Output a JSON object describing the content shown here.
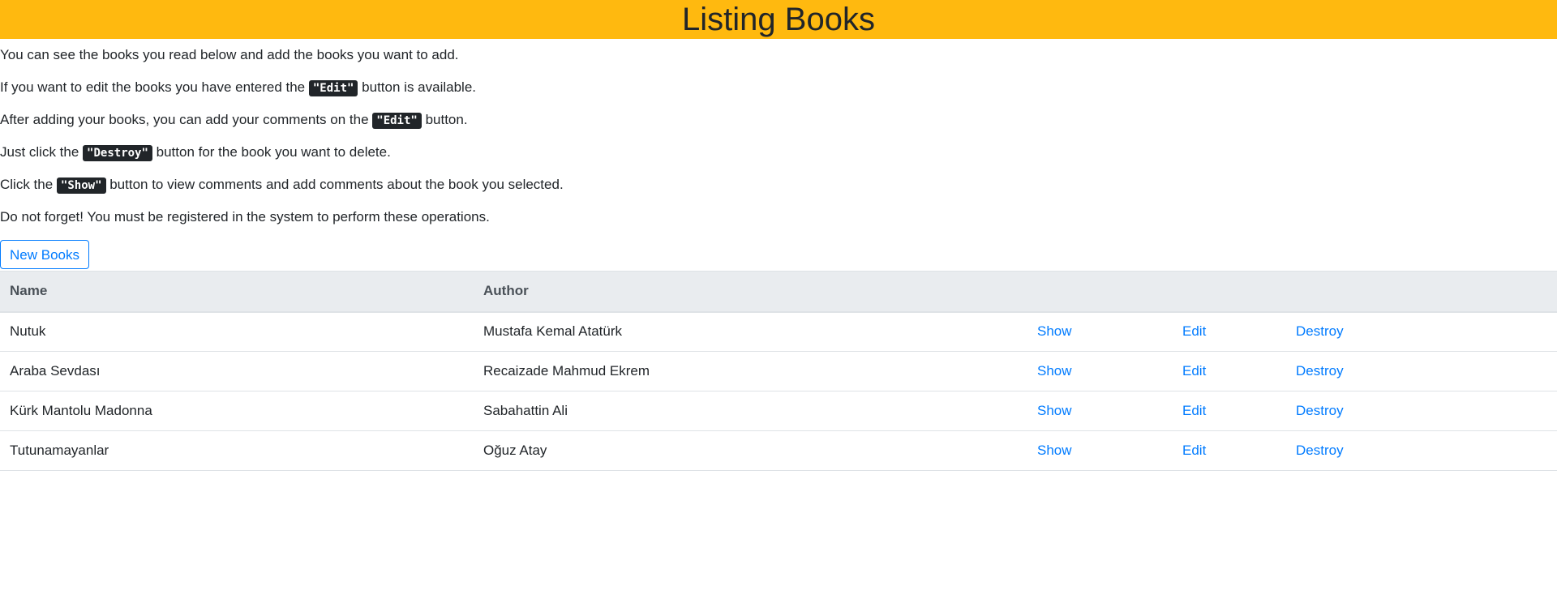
{
  "header": {
    "title": "Listing Books"
  },
  "intro": {
    "line1": "You can see the books you read below and add the books you want to add.",
    "line2_pre": "If you want to edit the books you have entered the ",
    "line2_code": "\"Edit\"",
    "line2_post": " button is available.",
    "line3_pre": "After adding your books, you can add your comments on the ",
    "line3_code": "\"Edit\"",
    "line3_post": " button.",
    "line4_pre": "Just click the ",
    "line4_code": "\"Destroy\"",
    "line4_post": " button for the book you want to delete.",
    "line5_pre": "Click the ",
    "line5_code": "\"Show\"",
    "line5_post": " button to view comments and add comments about the book you selected.",
    "line6": "Do not forget! You must be registered in the system to perform these operations."
  },
  "new_button": {
    "label": "New Books"
  },
  "table": {
    "headers": {
      "name": "Name",
      "author": "Author"
    },
    "rows": [
      {
        "name": "Nutuk",
        "author": "Mustafa Kemal Atatürk",
        "show": "Show",
        "edit": "Edit",
        "destroy": "Destroy"
      },
      {
        "name": "Araba Sevdası",
        "author": "Recaizade Mahmud Ekrem",
        "show": "Show",
        "edit": "Edit",
        "destroy": "Destroy"
      },
      {
        "name": "Kürk Mantolu Madonna",
        "author": "Sabahattin Ali",
        "show": "Show",
        "edit": "Edit",
        "destroy": "Destroy"
      },
      {
        "name": "Tutunamayanlar",
        "author": "Oğuz Atay",
        "show": "Show",
        "edit": "Edit",
        "destroy": "Destroy"
      }
    ]
  },
  "colors": {
    "header_bg": "#ffb90f",
    "link": "#007bff",
    "code_bg": "#212529",
    "table_head_bg": "#e9ecef"
  }
}
